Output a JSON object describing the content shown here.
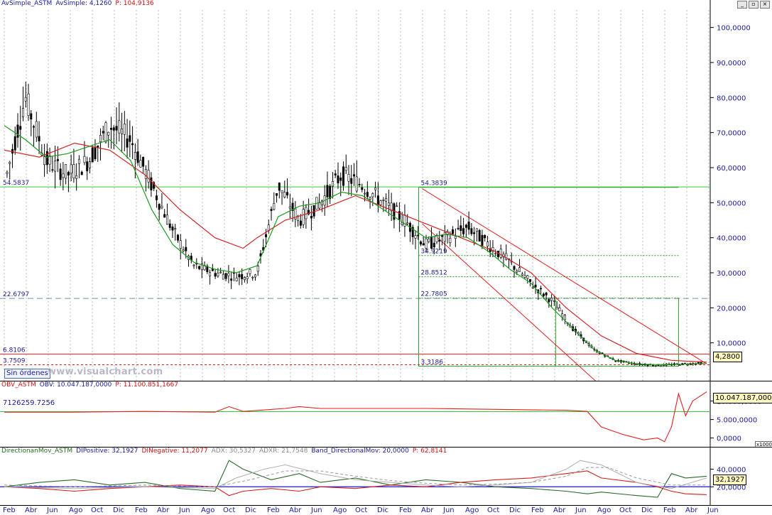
{
  "colors": {
    "price": "#000000",
    "ma_short": "#1e9a1e",
    "ma_long": "#d42020",
    "axis_label": "#1a1a99",
    "green_line": "#33cc33",
    "red_line": "#e02020",
    "grid": "#bbbbbb"
  },
  "window": {
    "buttons": [
      "minimize",
      "restore",
      "close"
    ]
  },
  "main": {
    "header": [
      {
        "text": "AvSimple_ASTM",
        "color": "blue"
      },
      {
        "text": "AvSimple: 4,1260",
        "color": "blue"
      },
      {
        "text": "P: 104,9136",
        "color": "red"
      }
    ],
    "last_price_tag": "4,2800",
    "orders_button": "Sin órdenes",
    "watermark": "www.visualchart.com"
  },
  "obv": {
    "header": [
      {
        "text": "OBV_ASTM",
        "color": "red"
      },
      {
        "text": "OBV: 10.047.187,0000",
        "color": "navy"
      },
      {
        "text": "P: 11.100.851,1667",
        "color": "red"
      }
    ],
    "level_label": "7126259.7256",
    "last_value_tag": "10.047.187,0000",
    "scale_note": "x1000"
  },
  "dmi": {
    "header": [
      {
        "text": "DirectionanMov_ASTM",
        "color": "green"
      },
      {
        "text": "DIPositive: 32,1927",
        "color": "navy"
      },
      {
        "text": "DINegative: 11,2077",
        "color": "red"
      },
      {
        "text": "ADX: 30,5327",
        "color": "gray"
      },
      {
        "text": "ADXR: 21,7548",
        "color": "gray"
      },
      {
        "text": "Band_DirectionalMov: 20,0000",
        "color": "navy"
      },
      {
        "text": "P: 62,8141",
        "color": "red"
      }
    ],
    "last_value_tag": "32,1927"
  },
  "chart_data": [
    {
      "type": "candlestick",
      "panel": "price",
      "ylim": [
        0,
        105
      ],
      "yticks": [
        {
          "v": 100,
          "label": "100,0000"
        },
        {
          "v": 90,
          "label": "90,0000"
        },
        {
          "v": 80,
          "label": "80,0000"
        },
        {
          "v": 70,
          "label": "70,0000"
        },
        {
          "v": 60,
          "label": "60,0000"
        },
        {
          "v": 50,
          "label": "50,0000"
        },
        {
          "v": 40,
          "label": "40,0000"
        },
        {
          "v": 30,
          "label": "30,0000"
        },
        {
          "v": 20,
          "label": "20,0000"
        },
        {
          "v": 10,
          "label": "10,0000"
        }
      ],
      "x_ticks": [
        "Feb",
        "Abr",
        "Jun",
        "Ago",
        "Oct",
        "Dic",
        "Feb",
        "Abr",
        "Jun",
        "Ago",
        "Oct",
        "Dic",
        "Feb",
        "Abr",
        "Jun",
        "Ago",
        "Oct",
        "Dic",
        "Feb",
        "Abr",
        "Jun",
        "Ago",
        "Oct",
        "Dic",
        "Feb",
        "Abr",
        "Jun",
        "Ago",
        "Oct",
        "Dic",
        "Feb",
        "Abr",
        "Jun"
      ],
      "close_path": [
        [
          0,
          55
        ],
        [
          3,
          80
        ],
        [
          6,
          62
        ],
        [
          9,
          58
        ],
        [
          12,
          62
        ],
        [
          15,
          72
        ],
        [
          18,
          68
        ],
        [
          21,
          55
        ],
        [
          24,
          42
        ],
        [
          27,
          32
        ],
        [
          30,
          30
        ],
        [
          33,
          29
        ],
        [
          36,
          30
        ],
        [
          39,
          55
        ],
        [
          42,
          45
        ],
        [
          45,
          50
        ],
        [
          48,
          58
        ],
        [
          51,
          55
        ],
        [
          54,
          50
        ],
        [
          57,
          45
        ],
        [
          60,
          38
        ],
        [
          63,
          40
        ],
        [
          66,
          43
        ],
        [
          69,
          38
        ],
        [
          72,
          33
        ],
        [
          75,
          27
        ],
        [
          78,
          22
        ],
        [
          81,
          14
        ],
        [
          84,
          8
        ],
        [
          87,
          5
        ],
        [
          90,
          4
        ],
        [
          93,
          3.6
        ],
        [
          96,
          3.9
        ],
        [
          100,
          4.28
        ]
      ],
      "ma_short": [
        [
          0,
          72
        ],
        [
          3,
          68
        ],
        [
          6,
          63
        ],
        [
          9,
          64
        ],
        [
          12,
          66
        ],
        [
          15,
          68
        ],
        [
          18,
          62
        ],
        [
          21,
          48
        ],
        [
          24,
          38
        ],
        [
          27,
          33
        ],
        [
          30,
          31
        ],
        [
          33,
          30
        ],
        [
          36,
          32
        ],
        [
          39,
          46
        ],
        [
          42,
          49
        ],
        [
          45,
          50
        ],
        [
          48,
          53
        ],
        [
          51,
          52
        ],
        [
          54,
          48
        ],
        [
          57,
          44
        ],
        [
          60,
          40
        ],
        [
          63,
          41
        ],
        [
          66,
          40
        ],
        [
          69,
          36
        ],
        [
          72,
          31
        ],
        [
          75,
          27
        ],
        [
          78,
          20
        ],
        [
          81,
          14
        ],
        [
          84,
          8
        ],
        [
          87,
          5
        ],
        [
          90,
          4
        ],
        [
          93,
          3.8
        ],
        [
          96,
          3.9
        ],
        [
          100,
          4.13
        ]
      ],
      "ma_long": [
        [
          0,
          65
        ],
        [
          5,
          63
        ],
        [
          10,
          67
        ],
        [
          15,
          65
        ],
        [
          20,
          58
        ],
        [
          25,
          48
        ],
        [
          30,
          40
        ],
        [
          34,
          37
        ],
        [
          36,
          40
        ],
        [
          40,
          45
        ],
        [
          45,
          48
        ],
        [
          50,
          52
        ],
        [
          55,
          48
        ],
        [
          60,
          44
        ],
        [
          65,
          40
        ],
        [
          70,
          36
        ],
        [
          75,
          30
        ],
        [
          80,
          20
        ],
        [
          85,
          12
        ],
        [
          90,
          7
        ],
        [
          95,
          5
        ],
        [
          100,
          4.5
        ]
      ],
      "horizontal_levels": [
        {
          "value": 54.5,
          "label": "54.5837",
          "style": "solid",
          "color": "green"
        },
        {
          "value": 22.68,
          "label": "22.6797",
          "style": "dashed",
          "color": "gray"
        },
        {
          "value": 6.81,
          "label": "6.8106",
          "style": "solid",
          "color": "red"
        },
        {
          "value": 3.75,
          "label": "3.7509",
          "style": "dashed",
          "color": "red"
        }
      ],
      "fibonacci": {
        "high": 54.3839,
        "low": 3.3186,
        "levels": [
          {
            "value": 54.3839,
            "label": "54.3839"
          },
          {
            "value": 34.9219,
            "label": "34.9219"
          },
          {
            "value": 28.8512,
            "label": "28.8512"
          },
          {
            "value": 22.7805,
            "label": "22.7805"
          },
          {
            "value": 3.3186,
            "label": "3.3186"
          }
        ],
        "x_from": 59,
        "x_to": 96
      }
    },
    {
      "type": "line",
      "panel": "obv",
      "ylim": [
        -2,
        13
      ],
      "yticks": [
        {
          "v": 10,
          "label": "10.000,0000"
        },
        {
          "v": 5,
          "label": "5.000,0000"
        },
        {
          "v": 0,
          "label": "0,0000"
        }
      ],
      "series": [
        {
          "values_path": [
            [
              0,
              7
            ],
            [
              10,
              7
            ],
            [
              20,
              7.2
            ],
            [
              30,
              7
            ],
            [
              32,
              8.5
            ],
            [
              34,
              7.2
            ],
            [
              40,
              8
            ],
            [
              42,
              8.5
            ],
            [
              45,
              8
            ],
            [
              60,
              8
            ],
            [
              80,
              7.5
            ],
            [
              83,
              7.2
            ],
            [
              85,
              3
            ],
            [
              88,
              1
            ],
            [
              91,
              -0.5
            ],
            [
              93,
              0
            ],
            [
              94,
              -1
            ],
            [
              95,
              3
            ],
            [
              96,
              12
            ],
            [
              97,
              6
            ],
            [
              98,
              10
            ],
            [
              100,
              12.5
            ]
          ]
        }
      ],
      "level": {
        "value": 7.13
      }
    },
    {
      "type": "line",
      "panel": "dmi",
      "ylim": [
        0,
        55
      ],
      "yticks": [
        {
          "v": 40,
          "label": "40,0000"
        },
        {
          "v": 20,
          "label": "20,0000"
        }
      ],
      "series": [
        {
          "name": "DIPositive",
          "values_path": [
            [
              0,
              20
            ],
            [
              5,
              25
            ],
            [
              10,
              28
            ],
            [
              15,
              22
            ],
            [
              20,
              25
            ],
            [
              25,
              18
            ],
            [
              30,
              15
            ],
            [
              32,
              50
            ],
            [
              34,
              40
            ],
            [
              38,
              28
            ],
            [
              42,
              35
            ],
            [
              45,
              25
            ],
            [
              50,
              30
            ],
            [
              55,
              22
            ],
            [
              60,
              28
            ],
            [
              65,
              25
            ],
            [
              70,
              20
            ],
            [
              75,
              18
            ],
            [
              80,
              15
            ],
            [
              83,
              12
            ],
            [
              85,
              14
            ],
            [
              90,
              10
            ],
            [
              93,
              8
            ],
            [
              95,
              35
            ],
            [
              97,
              30
            ],
            [
              100,
              32
            ]
          ]
        },
        {
          "name": "DINegative",
          "values_path": [
            [
              0,
              20
            ],
            [
              5,
              18
            ],
            [
              10,
              15
            ],
            [
              15,
              18
            ],
            [
              20,
              20
            ],
            [
              25,
              22
            ],
            [
              30,
              20
            ],
            [
              32,
              10
            ],
            [
              34,
              15
            ],
            [
              38,
              18
            ],
            [
              42,
              15
            ],
            [
              45,
              20
            ],
            [
              50,
              18
            ],
            [
              55,
              22
            ],
            [
              60,
              20
            ],
            [
              65,
              25
            ],
            [
              70,
              28
            ],
            [
              75,
              30
            ],
            [
              80,
              35
            ],
            [
              83,
              38
            ],
            [
              85,
              30
            ],
            [
              90,
              25
            ],
            [
              93,
              20
            ],
            [
              95,
              15
            ],
            [
              97,
              12
            ],
            [
              100,
              11
            ]
          ]
        },
        {
          "name": "ADX",
          "values_path": [
            [
              0,
              20
            ],
            [
              10,
              18
            ],
            [
              20,
              20
            ],
            [
              30,
              18
            ],
            [
              33,
              30
            ],
            [
              37,
              40
            ],
            [
              40,
              45
            ],
            [
              45,
              35
            ],
            [
              50,
              28
            ],
            [
              55,
              25
            ],
            [
              60,
              22
            ],
            [
              65,
              20
            ],
            [
              70,
              22
            ],
            [
              75,
              25
            ],
            [
              80,
              40
            ],
            [
              82,
              50
            ],
            [
              85,
              45
            ],
            [
              90,
              25
            ],
            [
              95,
              18
            ],
            [
              100,
              30
            ]
          ]
        },
        {
          "name": "ADXR",
          "values_path": [
            [
              0,
              22
            ],
            [
              10,
              20
            ],
            [
              20,
              22
            ],
            [
              30,
              20
            ],
            [
              35,
              28
            ],
            [
              40,
              38
            ],
            [
              45,
              38
            ],
            [
              50,
              32
            ],
            [
              55,
              27
            ],
            [
              60,
              24
            ],
            [
              65,
              22
            ],
            [
              70,
              23
            ],
            [
              75,
              25
            ],
            [
              80,
              32
            ],
            [
              83,
              42
            ],
            [
              86,
              42
            ],
            [
              90,
              30
            ],
            [
              95,
              22
            ],
            [
              100,
              22
            ]
          ]
        }
      ],
      "band": {
        "value": 20
      }
    }
  ]
}
